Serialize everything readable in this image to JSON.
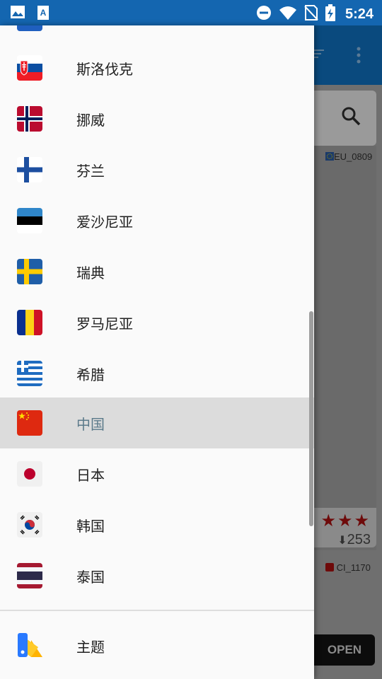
{
  "status_bar": {
    "time": "5:24",
    "icons": [
      "image-icon",
      "a-download-icon",
      "dnd-icon",
      "wifi-icon",
      "no-sim-icon",
      "battery-charging-icon"
    ]
  },
  "drawer": {
    "countries": [
      {
        "label": "斯洛伐克",
        "flag": "slovakia-flag-icon"
      },
      {
        "label": "挪威",
        "flag": "norway-flag-icon"
      },
      {
        "label": "芬兰",
        "flag": "finland-flag-icon"
      },
      {
        "label": "爱沙尼亚",
        "flag": "estonia-flag-icon"
      },
      {
        "label": "瑞典",
        "flag": "sweden-flag-icon"
      },
      {
        "label": "罗马尼亚",
        "flag": "romania-flag-icon"
      },
      {
        "label": "希腊",
        "flag": "greece-flag-icon"
      },
      {
        "label": "中国",
        "flag": "china-flag-icon",
        "selected": true
      },
      {
        "label": "日本",
        "flag": "japan-flag-icon"
      },
      {
        "label": "韩国",
        "flag": "korea-flag-icon"
      },
      {
        "label": "泰国",
        "flag": "thailand-flag-icon"
      }
    ],
    "theme": {
      "label": "主题",
      "icon": "theme-palette-icon"
    }
  },
  "background": {
    "code_top": "EU_0809",
    "code_bottom": "CI_1170",
    "downloads": "253",
    "open_button": "OPEN"
  },
  "colors": {
    "status_bar": "#1466b0",
    "selected_text": "#5b7a8a",
    "selected_bg": "#dcdcdc"
  }
}
